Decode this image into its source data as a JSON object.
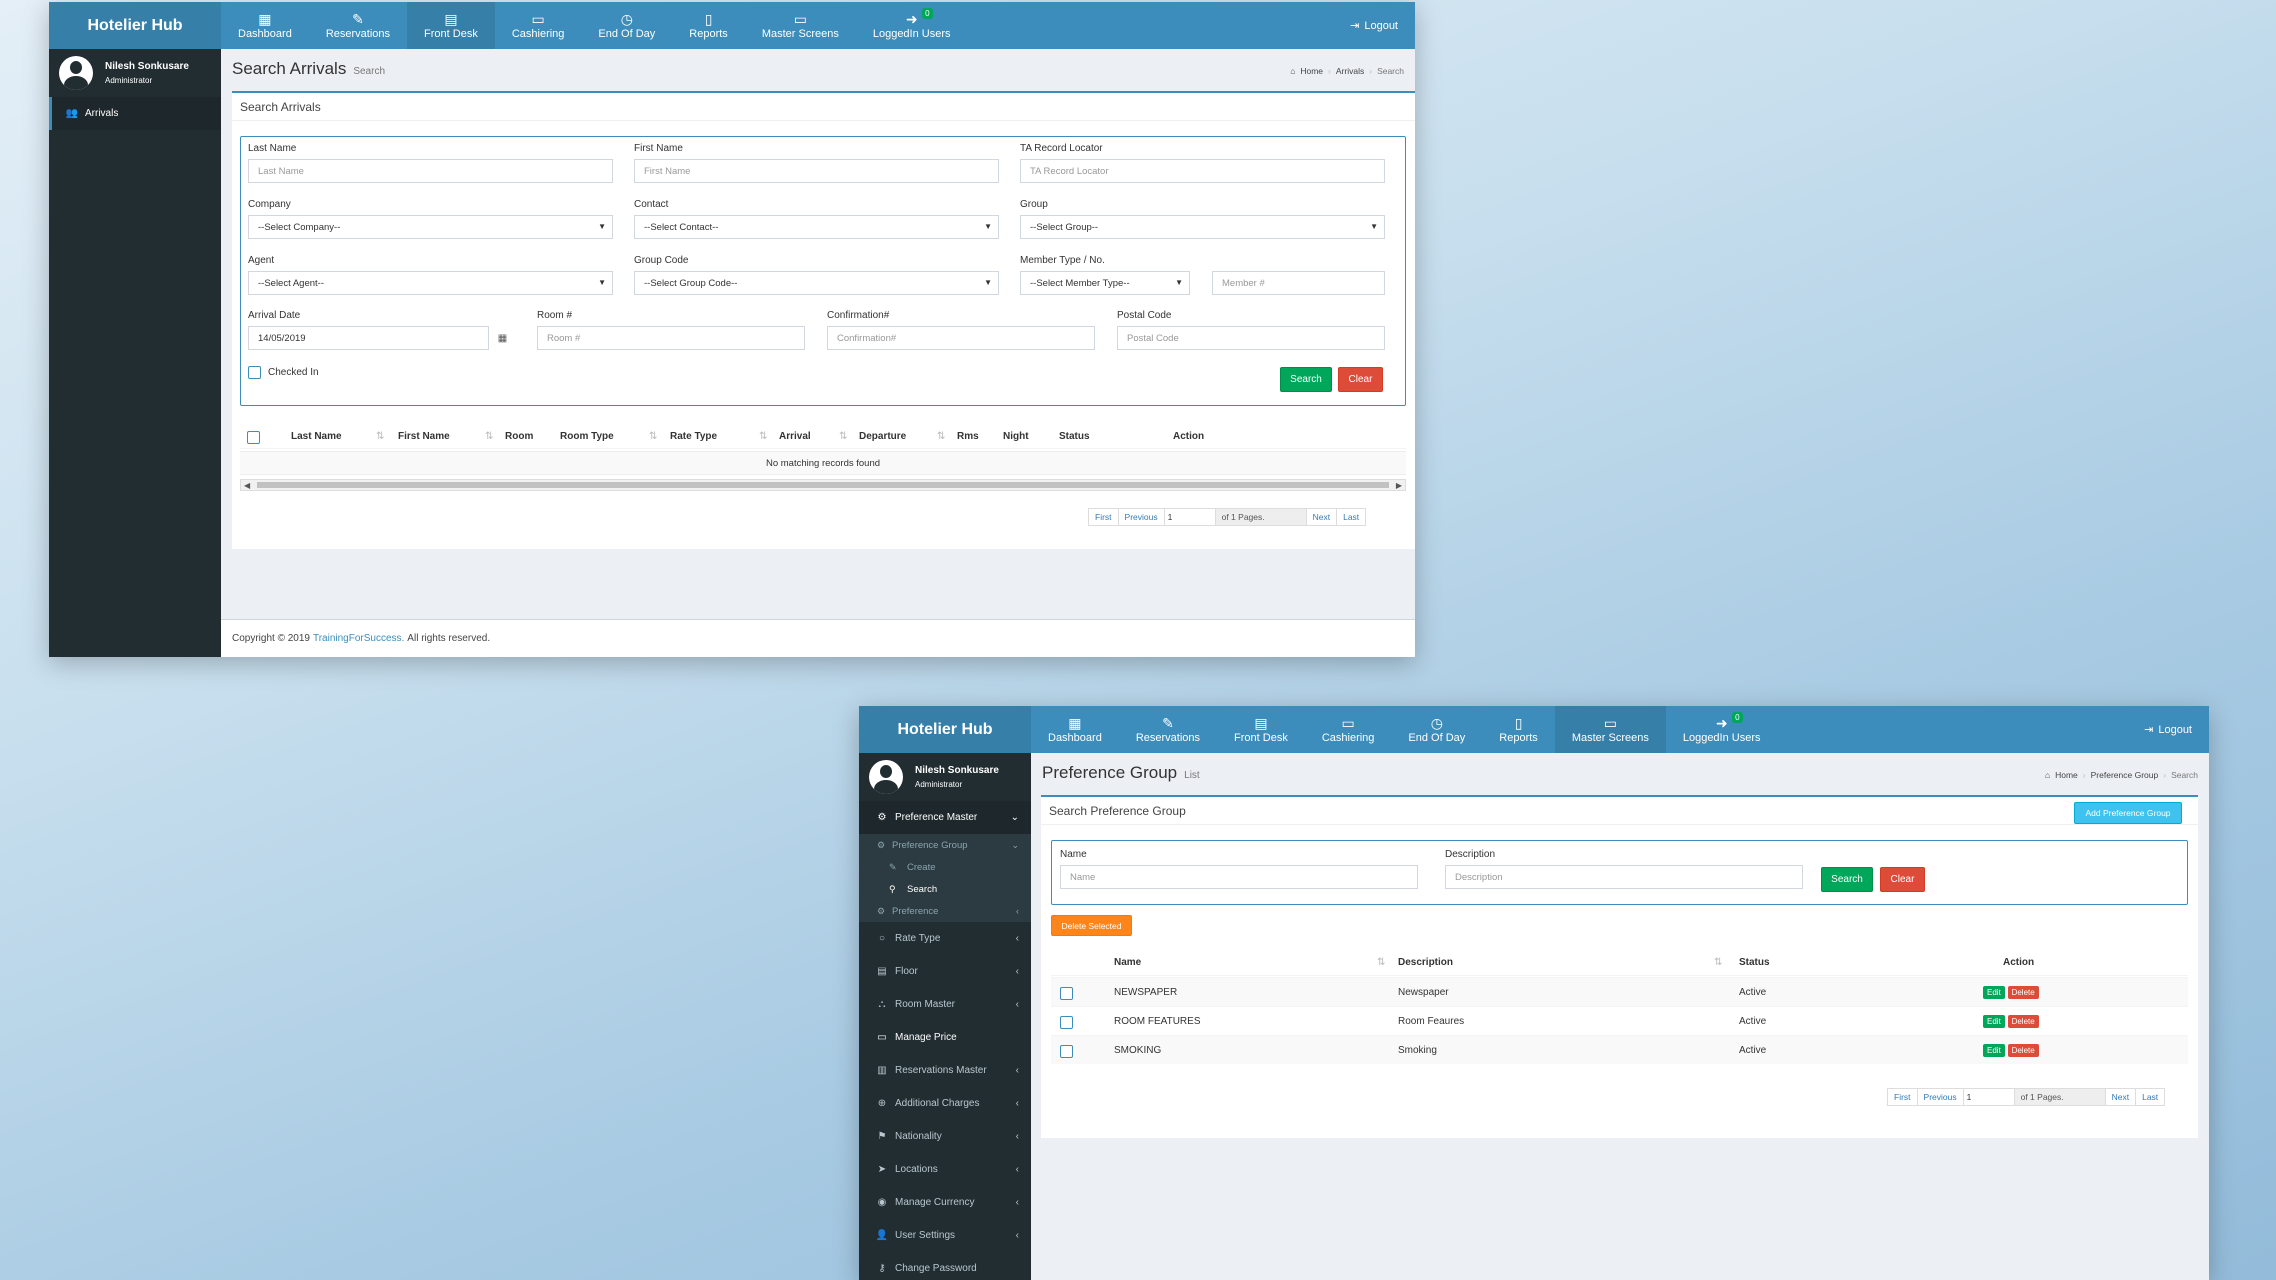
{
  "app": {
    "brand": "Hotelier Hub",
    "logout": "Logout",
    "loggedin_badge": "0",
    "nav": [
      {
        "label": "Dashboard",
        "icon": "▦"
      },
      {
        "label": "Reservations",
        "icon": "✎"
      },
      {
        "label": "Front Desk",
        "icon": "▤"
      },
      {
        "label": "Cashiering",
        "icon": "▭"
      },
      {
        "label": "End Of Day",
        "icon": "◷"
      },
      {
        "label": "Reports",
        "icon": "▯"
      },
      {
        "label": "Master Screens",
        "icon": "▭"
      },
      {
        "label": "LoggedIn Users",
        "icon": "➜"
      }
    ],
    "user": {
      "name": "Nilesh Sonkusare",
      "role": "Administrator"
    }
  },
  "win1": {
    "sidebar": {
      "item": "Arrivals"
    },
    "title": "Search Arrivals",
    "subtitle": "Search",
    "breadcrumb": {
      "home": "Home",
      "mid": "Arrivals",
      "last": "Search"
    },
    "box_title": "Search Arrivals",
    "form": {
      "last_name": {
        "label": "Last Name",
        "placeholder": "Last Name"
      },
      "first_name": {
        "label": "First Name",
        "placeholder": "First Name"
      },
      "ta_record": {
        "label": "TA Record Locator",
        "placeholder": "TA Record Locator"
      },
      "company": {
        "label": "Company",
        "value": "--Select Company--"
      },
      "contact": {
        "label": "Contact",
        "value": "--Select Contact--"
      },
      "group": {
        "label": "Group",
        "value": "--Select Group--"
      },
      "agent": {
        "label": "Agent",
        "value": "--Select Agent--"
      },
      "group_code": {
        "label": "Group Code",
        "value": "--Select Group Code--"
      },
      "member": {
        "label": "Member Type / No.",
        "value": "--Select Member Type--",
        "placeholder": "Member #"
      },
      "arrival_date": {
        "label": "Arrival Date",
        "value": "14/05/2019"
      },
      "room": {
        "label": "Room #",
        "placeholder": "Room #"
      },
      "confirmation": {
        "label": "Confirmation#",
        "placeholder": "Confirmation#"
      },
      "postal": {
        "label": "Postal Code",
        "placeholder": "Postal Code"
      },
      "checked_in": "Checked In",
      "search": "Search",
      "clear": "Clear"
    },
    "table": {
      "columns": [
        "Last Name",
        "First Name",
        "Room",
        "Room Type",
        "Rate Type",
        "Arrival",
        "Departure",
        "Rms",
        "Night",
        "Status",
        "Action"
      ],
      "empty": "No matching records found"
    },
    "pager": {
      "first": "First",
      "previous": "Previous",
      "page": "1",
      "of": "of 1 Pages.",
      "next": "Next",
      "last": "Last"
    },
    "footer": {
      "prefix": "Copyright © 2019",
      "link": "TrainingForSuccess.",
      "suffix": "All rights reserved."
    }
  },
  "win2": {
    "sidebar": {
      "preference_master": "Preference Master",
      "preference_group": "Preference Group",
      "create": "Create",
      "search": "Search",
      "preference": "Preference",
      "items": [
        "Rate Type",
        "Floor",
        "Room Master",
        "Manage Price",
        "Reservations Master",
        "Additional Charges",
        "Nationality",
        "Locations",
        "Manage Currency",
        "User Settings",
        "Change Password"
      ]
    },
    "title": "Preference Group",
    "subtitle": "List",
    "breadcrumb": {
      "home": "Home",
      "mid": "Preference Group",
      "last": "Search"
    },
    "box_title": "Search Preference Group",
    "add_button": "Add Preference Group",
    "form": {
      "name": {
        "label": "Name",
        "placeholder": "Name"
      },
      "description": {
        "label": "Description",
        "placeholder": "Description"
      },
      "search": "Search",
      "clear": "Clear"
    },
    "delete_selected": "Delete Selected",
    "table": {
      "columns": [
        "Name",
        "Description",
        "Status",
        "Action"
      ],
      "rows": [
        {
          "name": "NEWSPAPER",
          "description": "Newspaper",
          "status": "Active"
        },
        {
          "name": "ROOM FEATURES",
          "description": "Room Feaures",
          "status": "Active"
        },
        {
          "name": "SMOKING",
          "description": "Smoking",
          "status": "Active"
        }
      ],
      "edit": "Edit",
      "delete": "Delete"
    },
    "pager": {
      "first": "First",
      "previous": "Previous",
      "page": "1",
      "of": "of 1 Pages.",
      "next": "Next",
      "last": "Last"
    }
  }
}
